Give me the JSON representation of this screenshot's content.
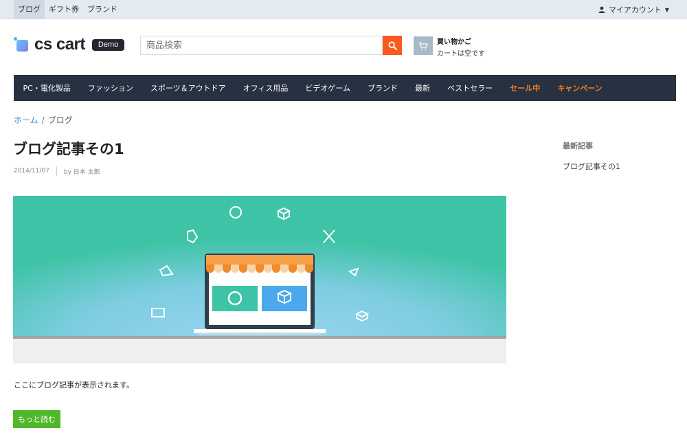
{
  "topbar": {
    "links": [
      "ブログ",
      "ギフト券",
      "ブランド"
    ],
    "account": "マイアカウント"
  },
  "header": {
    "logo_text": "cs cart",
    "logo_badge": "Demo",
    "search_placeholder": "商品検索",
    "cart_title": "買い物かご",
    "cart_status": "カートは空です"
  },
  "nav": {
    "items": [
      "PC・電化製品",
      "ファッション",
      "スポーツ＆アウトドア",
      "オフィス用品",
      "ビデオゲーム",
      "ブランド",
      "最新",
      "ベストセラー",
      "セール中",
      "キャンペーン"
    ]
  },
  "breadcrumb": {
    "home": "ホーム",
    "separator": "/",
    "current": "ブログ"
  },
  "post": {
    "title": "ブログ記事その1",
    "date": "2014/11/07",
    "author": "by 日本 太郎",
    "excerpt": "ここにブログ記事が表示されます。",
    "more_button": "もっと読む"
  },
  "sidebar": {
    "heading": "最新記事",
    "links": [
      "ブログ記事その1"
    ]
  },
  "colors": {
    "nav_bg": "#273142",
    "accent_orange": "#ff7a1a",
    "search_button": "#fb5a1f",
    "more_button": "#4fb829",
    "link_blue": "#3d8bcc"
  },
  "icons": [
    "user-icon",
    "search-icon",
    "cart-icon",
    "chevron-down-icon"
  ]
}
